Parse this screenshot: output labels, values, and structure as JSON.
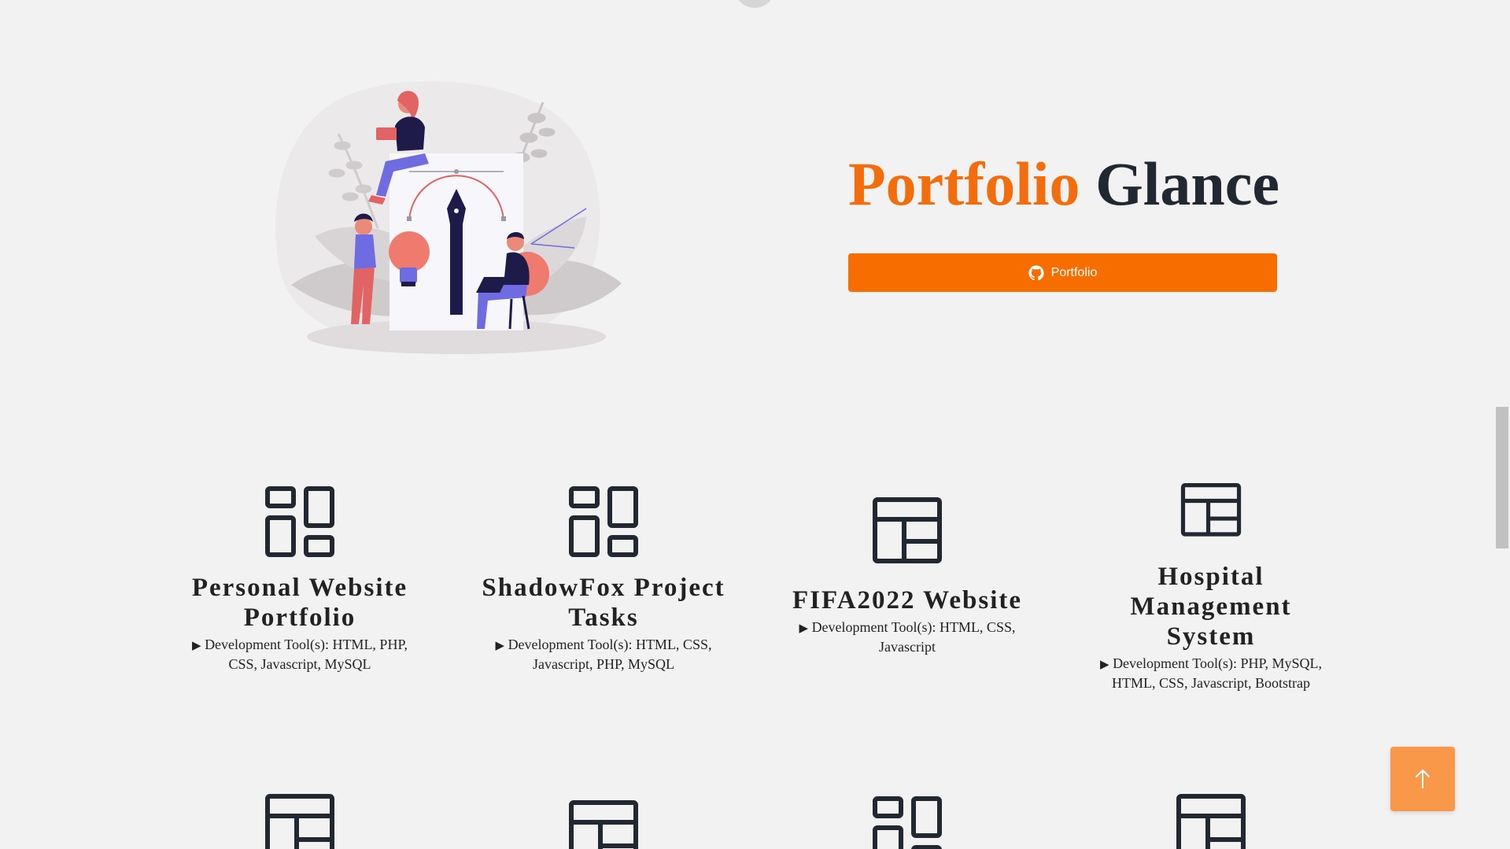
{
  "hero": {
    "title_accent": "Portfolio",
    "title_rest": "Glance",
    "button_label": "Portfolio",
    "button_icon": "github-icon",
    "accent_color": "#f46d0d",
    "button_color": "#f76d00"
  },
  "projects": [
    {
      "icon": "grid-layout-icon",
      "title_line1": "Personal Website",
      "title_line2": "Portfolio",
      "tools_line1": "Development Tool(s): HTML, PHP,",
      "tools_line2": "CSS, Javascript, MySQL"
    },
    {
      "icon": "grid-layout-icon",
      "title_line1": "ShadowFox Project",
      "title_line2": "Tasks",
      "tools_line1": "Development Tool(s): HTML, CSS,",
      "tools_line2": "Javascript, PHP, MySQL"
    },
    {
      "icon": "panel-layout-icon",
      "title_line1": "FIFA2022 Website",
      "tools_line1": "Development Tool(s): HTML, CSS,",
      "tools_line2": "Javascript"
    },
    {
      "icon": "panel-layout-icon",
      "title_line1": "Hospital",
      "title_line2": "Management",
      "title_line3": "System",
      "tools_line1": "Development Tool(s): PHP, MySQL,",
      "tools_line2": "HTML, CSS, Javascript, Bootstrap"
    }
  ],
  "next_row_icons": [
    "panel-layout-icon",
    "panel-layout-icon",
    "grid-layout-icon",
    "panel-layout-icon"
  ],
  "scroll_top": {
    "icon": "arrow-up-icon",
    "color": "#f89848"
  },
  "tools_marker": "▶"
}
